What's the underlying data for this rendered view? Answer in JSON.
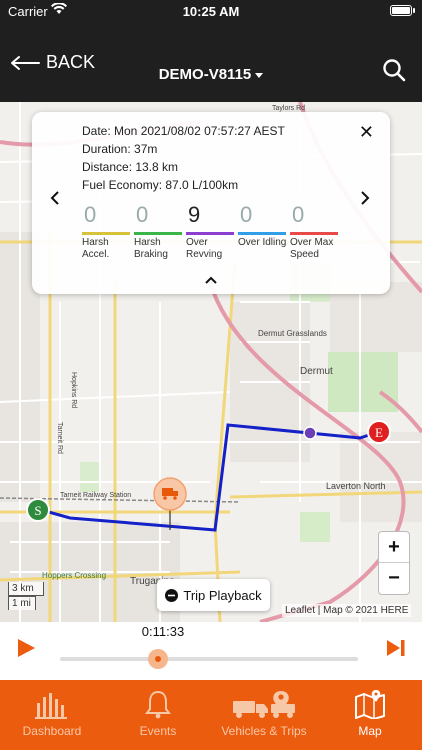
{
  "status_bar": {
    "carrier": "Carrier",
    "time": "10:25 AM"
  },
  "header": {
    "back_label": "BACK",
    "vehicle": "DEMO-V8115"
  },
  "trip": {
    "date": "Date: Mon 2021/08/02 07:57:27 AEST",
    "duration": "Duration: 37m",
    "distance": "Distance: 13.8 km",
    "fuel": "Fuel Economy: 87.0 L/100km",
    "metrics": [
      {
        "value": "0",
        "label1": "Harsh",
        "label2": "Accel.",
        "color": "#d8c23a"
      },
      {
        "value": "0",
        "label1": "Harsh",
        "label2": "Braking",
        "color": "#3bb54a"
      },
      {
        "value": "9",
        "label1": "Over",
        "label2": "Revving",
        "color": "#8b3fd1"
      },
      {
        "value": "0",
        "label1": "Over Idling",
        "label2": "",
        "color": "#2f9fe8"
      },
      {
        "value": "0",
        "label1": "Over Max",
        "label2": "Speed",
        "color": "#e84a4a"
      }
    ]
  },
  "map": {
    "start_marker": "S",
    "end_marker": "E",
    "zoom_in": "+",
    "zoom_out": "−",
    "scale_km": "3 km",
    "scale_mi": "1 mi",
    "attribution": "Leaflet | Map © 2021 HERE",
    "route_color": "#1420c8",
    "labels": {
      "dermut": "Dermut",
      "laverton_north": "Laverton North",
      "truganina": "Truganina",
      "dermut_grasslands": "Dermut Grasslands",
      "tarneit_station": "Tarneit Railway Station",
      "hoppers": "Hoppers Crossing",
      "taylors": "Taylors Rd",
      "hopkins": "Hopkins Rd",
      "tarneit_rd": "Tarneit Rd"
    }
  },
  "playback": {
    "button_label": "Trip Playback",
    "elapsed": "0:11:33",
    "progress": 0.33
  },
  "tabs": [
    {
      "label": "Dashboard",
      "icon": "dashboard-icon",
      "active": false
    },
    {
      "label": "Events",
      "icon": "bell-icon",
      "active": false
    },
    {
      "label": "Vehicles & Trips",
      "icon": "truck-pin-icon",
      "active": false
    },
    {
      "label": "Map",
      "icon": "map-icon",
      "active": true
    }
  ],
  "colors": {
    "accent": "#ec5c0f",
    "header": "#1f1f1f"
  }
}
